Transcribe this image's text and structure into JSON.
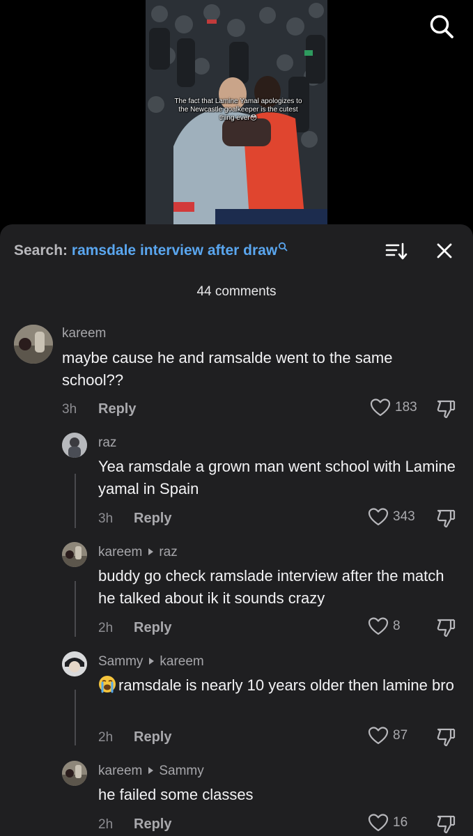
{
  "video": {
    "caption": "The fact that Lamine Yamal apologizes to the Newcastle goalkeeper is the cutest thing ever😳"
  },
  "header": {
    "search_prefix": "Search:",
    "search_query": "ramsdale interview after draw",
    "comment_count": "44 comments"
  },
  "comments": [
    {
      "user": "kareem",
      "reply_to": "",
      "text": "maybe cause he and ramsalde went to the same school??",
      "time": "3h",
      "reply_label": "Reply",
      "likes": "183"
    },
    {
      "user": "raz",
      "reply_to": "",
      "text": "Yea ramsdale a grown man went school with Lamine yamal in Spain",
      "time": "3h",
      "reply_label": "Reply",
      "likes": "343"
    },
    {
      "user": "kareem",
      "reply_to": "raz",
      "text": "buddy go check ramslade interview after the match he talked about ik it sounds crazy",
      "time": "2h",
      "reply_label": "Reply",
      "likes": "8"
    },
    {
      "user": "Sammy",
      "reply_to": "kareem",
      "text": "ramsdale is nearly 10 years older then lamine bro",
      "emoji": "😭",
      "time": "2h",
      "reply_label": "Reply",
      "likes": "87"
    },
    {
      "user": "kareem",
      "reply_to": "Sammy",
      "text": "he failed some classes",
      "time": "2h",
      "reply_label": "Reply",
      "likes": "16"
    }
  ],
  "colors": {
    "panel_bg": "#1f1f21",
    "search_query": "#5aa6ef",
    "muted_text": "#a6a6aa",
    "body_text": "#f3f3f5"
  },
  "icons": {
    "search": "search-icon",
    "sort": "sort-icon",
    "close": "close-icon",
    "like": "heart-icon",
    "dislike": "thumbs-down-icon"
  }
}
